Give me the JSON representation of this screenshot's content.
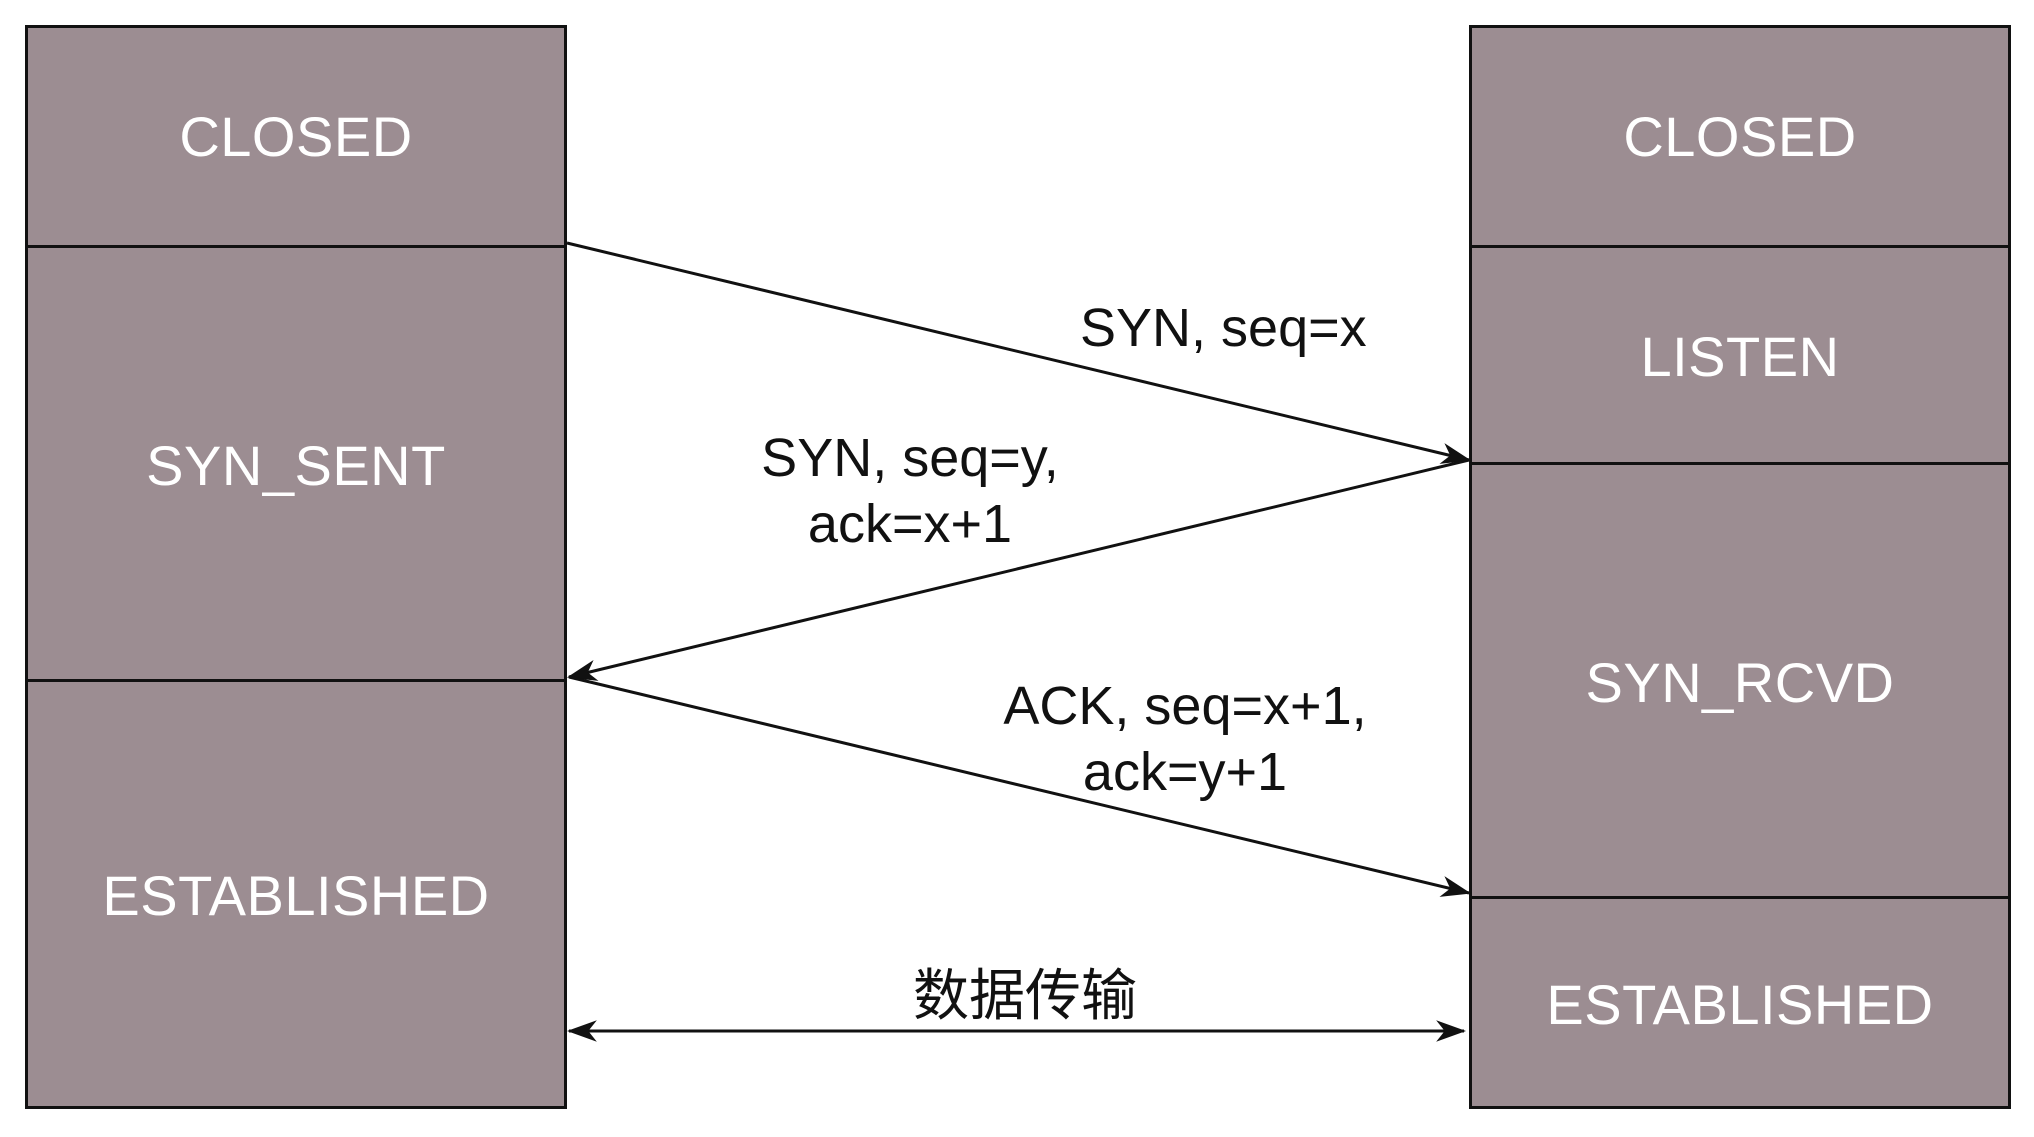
{
  "client": {
    "states": [
      "CLOSED",
      "SYN_SENT",
      "ESTABLISHED"
    ]
  },
  "server": {
    "states": [
      "CLOSED",
      "LISTEN",
      "SYN_RCVD",
      "ESTABLISHED"
    ]
  },
  "messages": {
    "syn": {
      "line1": "SYN, seq=x"
    },
    "synack": {
      "line1": "SYN, seq=y,",
      "line2": "ack=x+1"
    },
    "ack": {
      "line1": "ACK, seq=x+1,",
      "line2": "ack=y+1"
    },
    "data": {
      "line1": "数据传输"
    }
  },
  "colors": {
    "state_fill": "#9c8d92",
    "state_text": "#ffffff",
    "line": "#111111"
  }
}
